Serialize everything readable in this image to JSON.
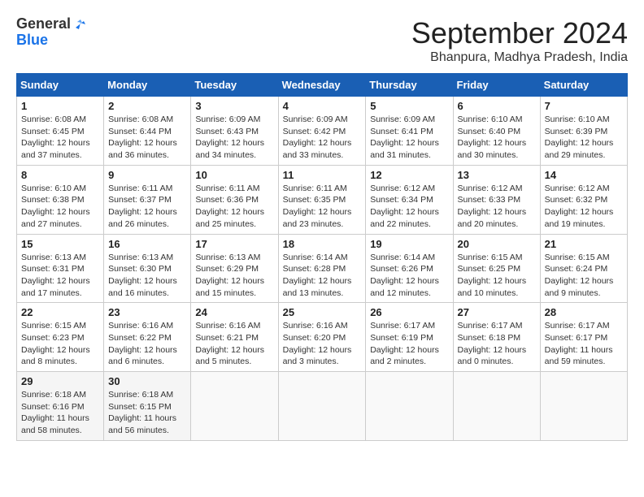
{
  "logo": {
    "line1": "General",
    "line2": "Blue"
  },
  "title": "September 2024",
  "location": "Bhanpura, Madhya Pradesh, India",
  "weekdays": [
    "Sunday",
    "Monday",
    "Tuesday",
    "Wednesday",
    "Thursday",
    "Friday",
    "Saturday"
  ],
  "weeks": [
    [
      {
        "day": "1",
        "rise": "6:08 AM",
        "set": "6:45 PM",
        "daylight": "12 hours and 37 minutes."
      },
      {
        "day": "2",
        "rise": "6:08 AM",
        "set": "6:44 PM",
        "daylight": "12 hours and 36 minutes."
      },
      {
        "day": "3",
        "rise": "6:09 AM",
        "set": "6:43 PM",
        "daylight": "12 hours and 34 minutes."
      },
      {
        "day": "4",
        "rise": "6:09 AM",
        "set": "6:42 PM",
        "daylight": "12 hours and 33 minutes."
      },
      {
        "day": "5",
        "rise": "6:09 AM",
        "set": "6:41 PM",
        "daylight": "12 hours and 31 minutes."
      },
      {
        "day": "6",
        "rise": "6:10 AM",
        "set": "6:40 PM",
        "daylight": "12 hours and 30 minutes."
      },
      {
        "day": "7",
        "rise": "6:10 AM",
        "set": "6:39 PM",
        "daylight": "12 hours and 29 minutes."
      }
    ],
    [
      {
        "day": "8",
        "rise": "6:10 AM",
        "set": "6:38 PM",
        "daylight": "12 hours and 27 minutes."
      },
      {
        "day": "9",
        "rise": "6:11 AM",
        "set": "6:37 PM",
        "daylight": "12 hours and 26 minutes."
      },
      {
        "day": "10",
        "rise": "6:11 AM",
        "set": "6:36 PM",
        "daylight": "12 hours and 25 minutes."
      },
      {
        "day": "11",
        "rise": "6:11 AM",
        "set": "6:35 PM",
        "daylight": "12 hours and 23 minutes."
      },
      {
        "day": "12",
        "rise": "6:12 AM",
        "set": "6:34 PM",
        "daylight": "12 hours and 22 minutes."
      },
      {
        "day": "13",
        "rise": "6:12 AM",
        "set": "6:33 PM",
        "daylight": "12 hours and 20 minutes."
      },
      {
        "day": "14",
        "rise": "6:12 AM",
        "set": "6:32 PM",
        "daylight": "12 hours and 19 minutes."
      }
    ],
    [
      {
        "day": "15",
        "rise": "6:13 AM",
        "set": "6:31 PM",
        "daylight": "12 hours and 17 minutes."
      },
      {
        "day": "16",
        "rise": "6:13 AM",
        "set": "6:30 PM",
        "daylight": "12 hours and 16 minutes."
      },
      {
        "day": "17",
        "rise": "6:13 AM",
        "set": "6:29 PM",
        "daylight": "12 hours and 15 minutes."
      },
      {
        "day": "18",
        "rise": "6:14 AM",
        "set": "6:28 PM",
        "daylight": "12 hours and 13 minutes."
      },
      {
        "day": "19",
        "rise": "6:14 AM",
        "set": "6:26 PM",
        "daylight": "12 hours and 12 minutes."
      },
      {
        "day": "20",
        "rise": "6:15 AM",
        "set": "6:25 PM",
        "daylight": "12 hours and 10 minutes."
      },
      {
        "day": "21",
        "rise": "6:15 AM",
        "set": "6:24 PM",
        "daylight": "12 hours and 9 minutes."
      }
    ],
    [
      {
        "day": "22",
        "rise": "6:15 AM",
        "set": "6:23 PM",
        "daylight": "12 hours and 8 minutes."
      },
      {
        "day": "23",
        "rise": "6:16 AM",
        "set": "6:22 PM",
        "daylight": "12 hours and 6 minutes."
      },
      {
        "day": "24",
        "rise": "6:16 AM",
        "set": "6:21 PM",
        "daylight": "12 hours and 5 minutes."
      },
      {
        "day": "25",
        "rise": "6:16 AM",
        "set": "6:20 PM",
        "daylight": "12 hours and 3 minutes."
      },
      {
        "day": "26",
        "rise": "6:17 AM",
        "set": "6:19 PM",
        "daylight": "12 hours and 2 minutes."
      },
      {
        "day": "27",
        "rise": "6:17 AM",
        "set": "6:18 PM",
        "daylight": "12 hours and 0 minutes."
      },
      {
        "day": "28",
        "rise": "6:17 AM",
        "set": "6:17 PM",
        "daylight": "11 hours and 59 minutes."
      }
    ],
    [
      {
        "day": "29",
        "rise": "6:18 AM",
        "set": "6:16 PM",
        "daylight": "11 hours and 58 minutes."
      },
      {
        "day": "30",
        "rise": "6:18 AM",
        "set": "6:15 PM",
        "daylight": "11 hours and 56 minutes."
      },
      null,
      null,
      null,
      null,
      null
    ]
  ],
  "labels": {
    "sunrise": "Sunrise:",
    "sunset": "Sunset:",
    "daylight": "Daylight:"
  }
}
